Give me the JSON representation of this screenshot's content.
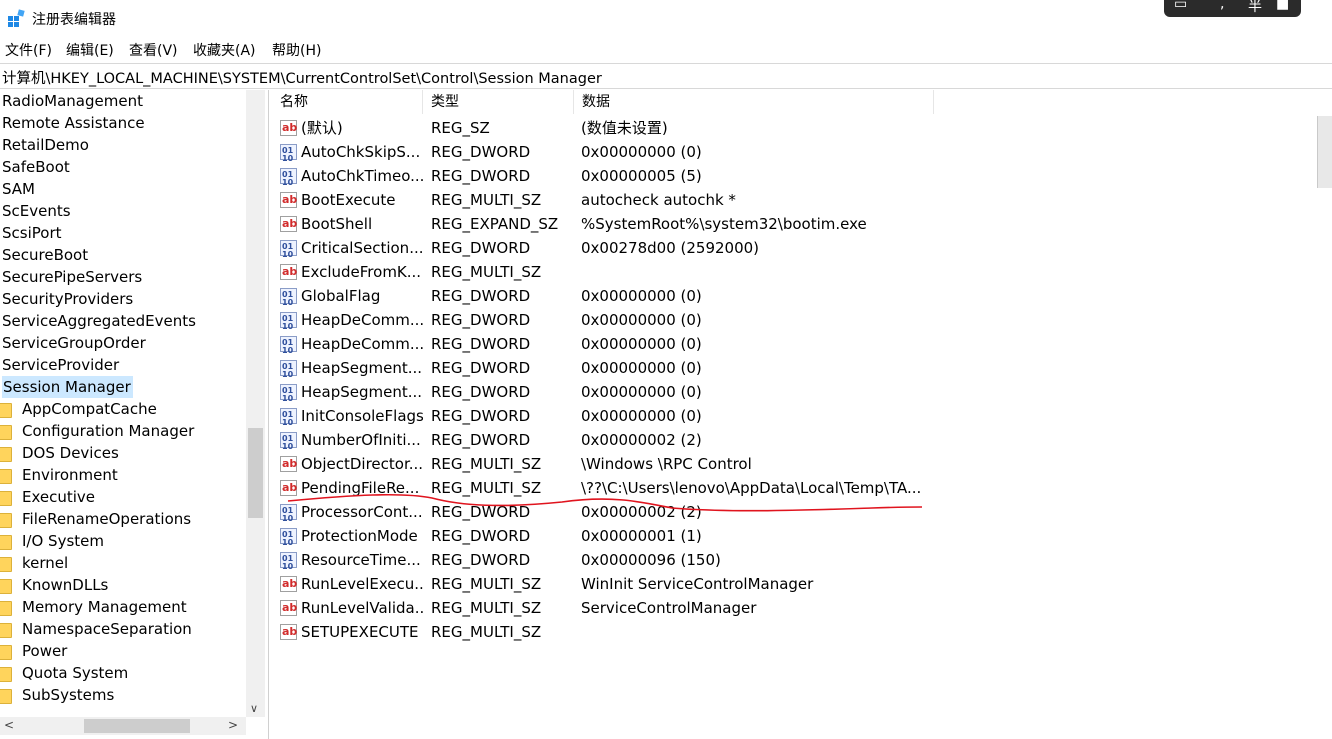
{
  "window": {
    "title": "注册表编辑器"
  },
  "menu": [
    "文件(F)",
    "编辑(E)",
    "查看(V)",
    "收藏夹(A)",
    "帮助(H)"
  ],
  "address": "计算机\\HKEY_LOCAL_MACHINE\\SYSTEM\\CurrentControlSet\\Control\\Session Manager",
  "tree": {
    "items": [
      {
        "label": "RadioManagement",
        "child": false,
        "selected": false
      },
      {
        "label": "Remote Assistance",
        "child": false,
        "selected": false
      },
      {
        "label": "RetailDemo",
        "child": false,
        "selected": false
      },
      {
        "label": "SafeBoot",
        "child": false,
        "selected": false
      },
      {
        "label": "SAM",
        "child": false,
        "selected": false
      },
      {
        "label": "ScEvents",
        "child": false,
        "selected": false
      },
      {
        "label": "ScsiPort",
        "child": false,
        "selected": false
      },
      {
        "label": "SecureBoot",
        "child": false,
        "selected": false
      },
      {
        "label": "SecurePipeServers",
        "child": false,
        "selected": false
      },
      {
        "label": "SecurityProviders",
        "child": false,
        "selected": false
      },
      {
        "label": "ServiceAggregatedEvents",
        "child": false,
        "selected": false
      },
      {
        "label": "ServiceGroupOrder",
        "child": false,
        "selected": false
      },
      {
        "label": "ServiceProvider",
        "child": false,
        "selected": false
      },
      {
        "label": "Session Manager",
        "child": false,
        "selected": true
      },
      {
        "label": "AppCompatCache",
        "child": true,
        "selected": false
      },
      {
        "label": "Configuration Manager",
        "child": true,
        "selected": false
      },
      {
        "label": "DOS Devices",
        "child": true,
        "selected": false
      },
      {
        "label": "Environment",
        "child": true,
        "selected": false
      },
      {
        "label": "Executive",
        "child": true,
        "selected": false
      },
      {
        "label": "FileRenameOperations",
        "child": true,
        "selected": false
      },
      {
        "label": "I/O System",
        "child": true,
        "selected": false
      },
      {
        "label": "kernel",
        "child": true,
        "selected": false
      },
      {
        "label": "KnownDLLs",
        "child": true,
        "selected": false
      },
      {
        "label": "Memory Management",
        "child": true,
        "selected": false
      },
      {
        "label": "NamespaceSeparation",
        "child": true,
        "selected": false
      },
      {
        "label": "Power",
        "child": true,
        "selected": false
      },
      {
        "label": "Quota System",
        "child": true,
        "selected": false
      },
      {
        "label": "SubSystems",
        "child": true,
        "selected": false
      }
    ]
  },
  "columns": {
    "name": "名称",
    "type": "类型",
    "data": "数据"
  },
  "values": [
    {
      "icon": "sz",
      "name": "(默认)",
      "type": "REG_SZ",
      "data": "(数值未设置)"
    },
    {
      "icon": "dword",
      "name": "AutoChkSkipS...",
      "type": "REG_DWORD",
      "data": "0x00000000 (0)"
    },
    {
      "icon": "dword",
      "name": "AutoChkTimeo...",
      "type": "REG_DWORD",
      "data": "0x00000005 (5)"
    },
    {
      "icon": "sz",
      "name": "BootExecute",
      "type": "REG_MULTI_SZ",
      "data": "autocheck autochk *"
    },
    {
      "icon": "sz",
      "name": "BootShell",
      "type": "REG_EXPAND_SZ",
      "data": "%SystemRoot%\\system32\\bootim.exe"
    },
    {
      "icon": "dword",
      "name": "CriticalSection...",
      "type": "REG_DWORD",
      "data": "0x00278d00 (2592000)"
    },
    {
      "icon": "sz",
      "name": "ExcludeFromK...",
      "type": "REG_MULTI_SZ",
      "data": ""
    },
    {
      "icon": "dword",
      "name": "GlobalFlag",
      "type": "REG_DWORD",
      "data": "0x00000000 (0)"
    },
    {
      "icon": "dword",
      "name": "HeapDeComm...",
      "type": "REG_DWORD",
      "data": "0x00000000 (0)"
    },
    {
      "icon": "dword",
      "name": "HeapDeComm...",
      "type": "REG_DWORD",
      "data": "0x00000000 (0)"
    },
    {
      "icon": "dword",
      "name": "HeapSegment...",
      "type": "REG_DWORD",
      "data": "0x00000000 (0)"
    },
    {
      "icon": "dword",
      "name": "HeapSegment...",
      "type": "REG_DWORD",
      "data": "0x00000000 (0)"
    },
    {
      "icon": "dword",
      "name": "InitConsoleFlags",
      "type": "REG_DWORD",
      "data": "0x00000000 (0)"
    },
    {
      "icon": "dword",
      "name": "NumberOfIniti...",
      "type": "REG_DWORD",
      "data": "0x00000002 (2)"
    },
    {
      "icon": "sz",
      "name": "ObjectDirector...",
      "type": "REG_MULTI_SZ",
      "data": "\\Windows \\RPC Control"
    },
    {
      "icon": "sz",
      "name": "PendingFileRe...",
      "type": "REG_MULTI_SZ",
      "data": "\\??\\C:\\Users\\lenovo\\AppData\\Local\\Temp\\TA..."
    },
    {
      "icon": "dword",
      "name": "ProcessorCont...",
      "type": "REG_DWORD",
      "data": "0x00000002 (2)"
    },
    {
      "icon": "dword",
      "name": "ProtectionMode",
      "type": "REG_DWORD",
      "data": "0x00000001 (1)"
    },
    {
      "icon": "dword",
      "name": "ResourceTime...",
      "type": "REG_DWORD",
      "data": "0x00000096 (150)"
    },
    {
      "icon": "sz",
      "name": "RunLevelExecu...",
      "type": "REG_MULTI_SZ",
      "data": "WinInit ServiceControlManager"
    },
    {
      "icon": "sz",
      "name": "RunLevelValida...",
      "type": "REG_MULTI_SZ",
      "data": "ServiceControlManager"
    },
    {
      "icon": "sz",
      "name": "SETUPEXECUTE",
      "type": "REG_MULTI_SZ",
      "data": ""
    }
  ],
  "colors": {
    "selection": "#cce8ff",
    "annotation": "#e0141e",
    "folder": "#ffd45c"
  }
}
